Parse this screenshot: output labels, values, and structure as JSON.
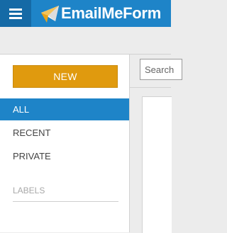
{
  "header": {
    "brand": "EmailMeForm",
    "menu_icon": "hamburger-menu-icon",
    "logo_icon": "envelope-icon",
    "colors": {
      "bar": "#1e84c8",
      "menu_button": "#156aa6"
    }
  },
  "sidebar": {
    "new_button_label": "NEW",
    "new_button_color": "#e09a0e",
    "items": [
      {
        "label": "ALL",
        "active": true
      },
      {
        "label": "RECENT",
        "active": false
      },
      {
        "label": "PRIVATE",
        "active": false
      }
    ],
    "labels_heading": "LABELS"
  },
  "search": {
    "placeholder": "Search"
  }
}
